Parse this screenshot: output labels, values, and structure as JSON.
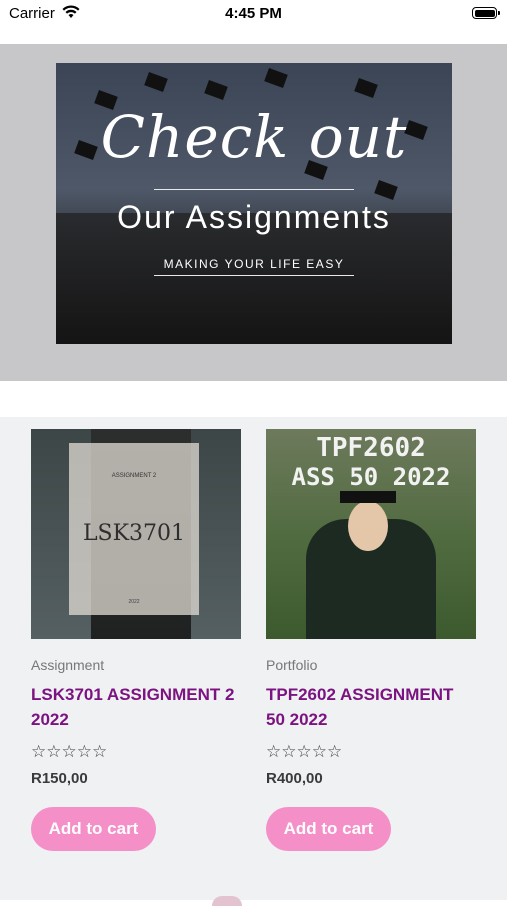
{
  "status": {
    "carrier": "Carrier",
    "time": "4:45 PM"
  },
  "banner": {
    "title": "Check out",
    "subtitle": "Our Assignments",
    "tagline": "MAKING YOUR LIFE EASY"
  },
  "products": [
    {
      "thumb_label": "LSK3701",
      "thumb_small": "ASSIGNMENT 2",
      "thumb_year": "2022",
      "category": "Assignment",
      "title": "LSK3701 ASSIGNMENT 2 2022",
      "stars": "☆☆☆☆☆",
      "price": "R150,00",
      "button": "Add to cart"
    },
    {
      "thumb_line1": "TPF2602",
      "thumb_line2": "ASS 50 2022",
      "category": "Portfolio",
      "title": "TPF2602 ASSIGNMENT 50 2022",
      "stars": "☆☆☆☆☆",
      "price": "R400,00",
      "button": "Add to cart"
    }
  ],
  "colors": {
    "accent": "#7b1481",
    "button": "#f58fc8",
    "hero_bg": "#c7c7c9",
    "section_bg": "#f0f1f3"
  }
}
